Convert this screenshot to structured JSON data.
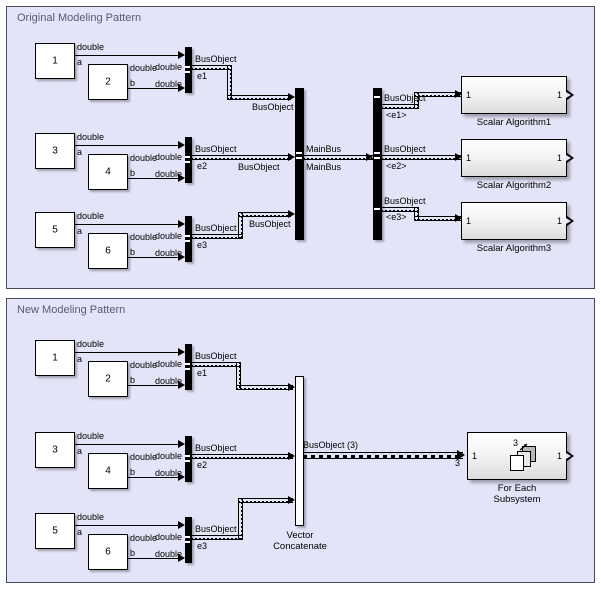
{
  "diagram": {
    "type": "simulink-block-diagram",
    "background": "#ffffff",
    "panel_fill": "#e4e4f8",
    "panel_border": "#4a4a5e"
  },
  "panels": [
    {
      "id": "original",
      "title": "Original Modeling Pattern"
    },
    {
      "id": "new",
      "title": "New Modeling Pattern"
    }
  ],
  "constants": {
    "top": [
      "1",
      "2",
      "3",
      "4",
      "5",
      "6"
    ],
    "bottom": [
      "1",
      "2",
      "3",
      "4",
      "5",
      "6"
    ]
  },
  "signal_labels": {
    "double": "double",
    "a": "a",
    "b": "b",
    "busobject": "BusObject",
    "mainbus": "MainBus",
    "e1": "e1",
    "e2": "e2",
    "e3": "e3",
    "sel_e1": "<e1>",
    "sel_e2": "<e2>",
    "sel_e3": "<e3>",
    "busobject_vector": "BusObject (3)",
    "width3": "3"
  },
  "blocks": {
    "scalar_algorithms": [
      {
        "name": "Scalar Algorithm1",
        "in_port": "1",
        "out_port": "1"
      },
      {
        "name": "Scalar Algorithm2",
        "in_port": "1",
        "out_port": "1"
      },
      {
        "name": "Scalar Algorithm3",
        "in_port": "1",
        "out_port": "1"
      }
    ],
    "vector_concatenate": {
      "name_line1": "Vector",
      "name_line2": "Concatenate"
    },
    "for_each_subsystem": {
      "name_line1": "For Each",
      "name_line2": "Subsystem",
      "in_port": "1",
      "out_port": "1",
      "icon_count": "3"
    }
  }
}
